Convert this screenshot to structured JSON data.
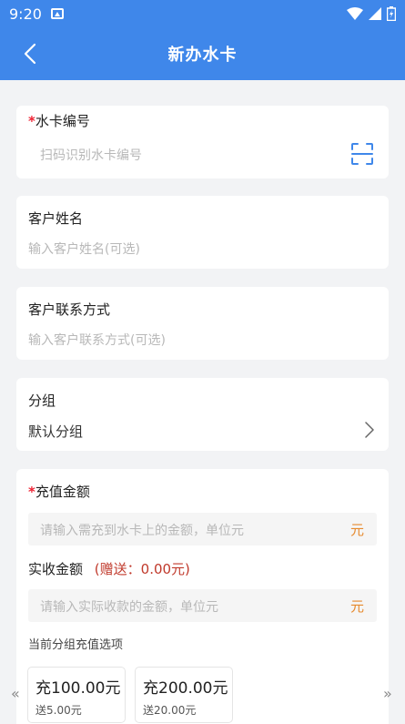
{
  "status": {
    "time": "9:20"
  },
  "header": {
    "title": "新办水卡"
  },
  "card_no": {
    "required_mark": "*",
    "label": "水卡编号",
    "placeholder": "扫码识别水卡编号"
  },
  "customer_name": {
    "label": "客户姓名",
    "placeholder": "输入客户姓名(可选)"
  },
  "customer_contact": {
    "label": "客户联系方式",
    "placeholder": "输入客户联系方式(可选)"
  },
  "group": {
    "label": "分组",
    "value": "默认分组"
  },
  "recharge": {
    "required_mark": "*",
    "label": "充值金额",
    "placeholder": "请输入需充到水卡上的金额，单位元",
    "unit": "元"
  },
  "received": {
    "label": "实收金额",
    "gift_text": "(赠送：0.00元)",
    "placeholder": "请输入实际收款的金额，单位元",
    "unit": "元"
  },
  "options_section": {
    "label": "当前分组充值选项",
    "options": [
      {
        "amount": "充100.00元",
        "bonus": "送5.00元"
      },
      {
        "amount": "充200.00元",
        "bonus": "送20.00元"
      }
    ]
  },
  "scroll": {
    "left": "«",
    "right": "»"
  }
}
